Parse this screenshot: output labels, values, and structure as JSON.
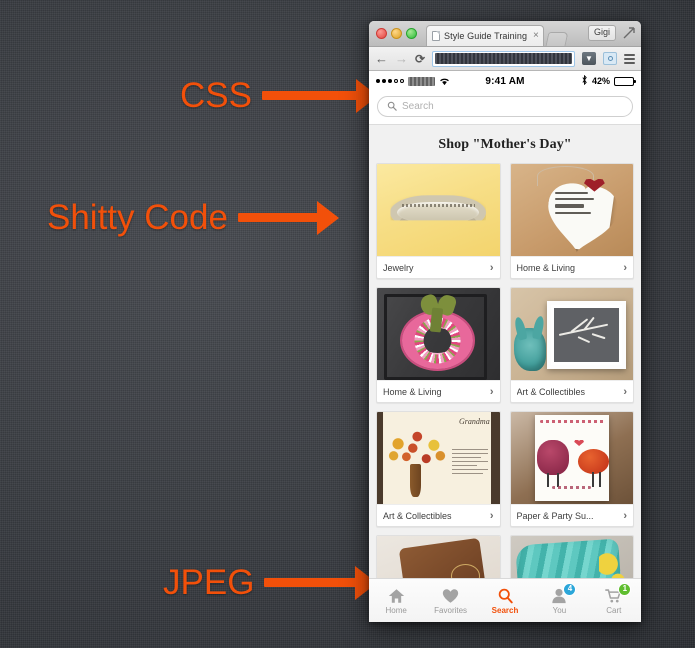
{
  "annotations": [
    {
      "id": "css",
      "label": "CSS"
    },
    {
      "id": "shitty",
      "label": "Shitty Code"
    },
    {
      "id": "jpeg",
      "label": "JPEG"
    }
  ],
  "colors": {
    "annotation_orange": "#f2500a",
    "accent_orange": "#f2500a",
    "badge_blue": "#2ba6d9",
    "badge_green": "#5fbd2e",
    "desktop_background": "#3c3f44"
  },
  "browser": {
    "tab_title": "Style Guide Training",
    "tab_close_label": "×",
    "profile_label": "Gigi",
    "url_value": "",
    "back_icon": "←",
    "forward_icon": "→",
    "reload_icon": "⟳",
    "icons": {
      "favicon": "page-icon",
      "new_tab": "new-tab-icon",
      "fullscreen": "fullscreen-icon",
      "downloads": "downloads-icon",
      "screenshot": "camera-icon",
      "menu": "hamburger-menu-icon"
    }
  },
  "phone": {
    "status_bar": {
      "signal_filled": 3,
      "signal_total": 5,
      "carrier": "",
      "wifi": "wifi-icon",
      "time": "9:41 AM",
      "bluetooth": "✶",
      "battery_percent": "42%",
      "battery_fill": 42
    },
    "search": {
      "placeholder": "Search",
      "icon": "search-icon"
    },
    "heading": "Shop \"Mother's Day\"",
    "cards": [
      {
        "label": "Jewelry",
        "art": "jewelry",
        "chevron": "›"
      },
      {
        "label": "Home & Living",
        "art": "heart",
        "chevron": "›"
      },
      {
        "label": "Home & Living",
        "art": "wreath",
        "chevron": "›"
      },
      {
        "label": "Art & Collectibles",
        "art": "frame",
        "chevron": "›"
      },
      {
        "label": "Art & Collectibles",
        "art": "tree",
        "chevron": "›"
      },
      {
        "label": "Paper & Party Su...",
        "art": "grape",
        "chevron": "›"
      }
    ],
    "partial_cards": [
      {
        "art": "leather"
      },
      {
        "art": "scarf"
      }
    ],
    "tabbar": [
      {
        "label": "Home",
        "icon": "home-icon",
        "active": false,
        "badge": null,
        "badge_color": null
      },
      {
        "label": "Favorites",
        "icon": "heart-icon",
        "active": false,
        "badge": null,
        "badge_color": null
      },
      {
        "label": "Search",
        "icon": "search-icon",
        "active": true,
        "badge": null,
        "badge_color": null
      },
      {
        "label": "You",
        "icon": "person-icon",
        "active": false,
        "badge": "4",
        "badge_color": "#2ba6d9"
      },
      {
        "label": "Cart",
        "icon": "cart-icon",
        "active": false,
        "badge": "1",
        "badge_color": "#5fbd2e"
      }
    ]
  }
}
